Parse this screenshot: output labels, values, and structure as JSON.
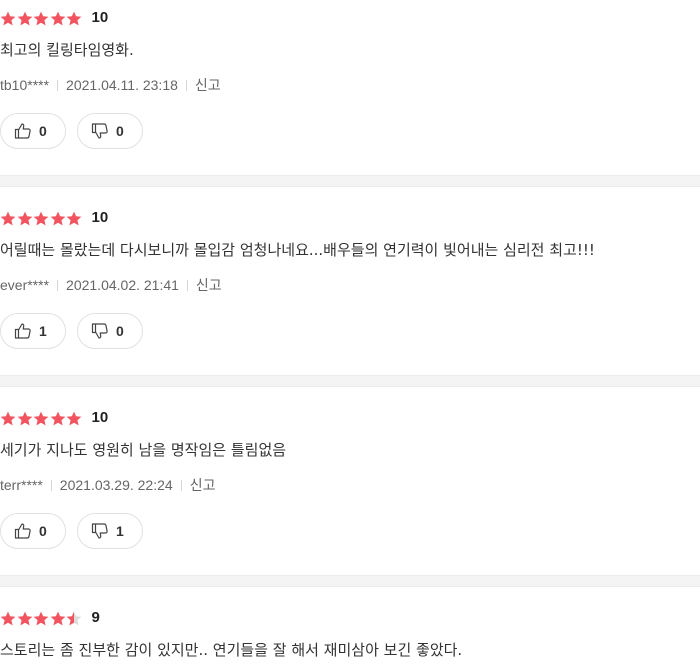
{
  "colors": {
    "star_filled": "#f2545f",
    "star_empty": "#dcdcdc"
  },
  "reviews": [
    {
      "stars": 5,
      "score": "10",
      "comment": "최고의 킬링타임영화.",
      "author": "tb10****",
      "datetime": "2021.04.11. 23:18",
      "report_label": "신고",
      "likes": "0",
      "dislikes": "0"
    },
    {
      "stars": 5,
      "score": "10",
      "comment": "어릴때는 몰랐는데 다시보니까 몰입감 엄청나네요...배우들의 연기력이 빛어내는 심리전 최고!!!",
      "author": "ever****",
      "datetime": "2021.04.02. 21:41",
      "report_label": "신고",
      "likes": "1",
      "dislikes": "0"
    },
    {
      "stars": 5,
      "score": "10",
      "comment": "세기가 지나도 영원히 남을 명작임은 틀림없음",
      "author": "terr****",
      "datetime": "2021.03.29. 22:24",
      "report_label": "신고",
      "likes": "0",
      "dislikes": "1"
    },
    {
      "stars": 4.5,
      "score": "9",
      "comment": "스토리는 좀 진부한 감이 있지만.. 연기들을 잘 해서 재미삼아 보긴 좋았다.",
      "author": "",
      "datetime": "",
      "report_label": "",
      "likes": "",
      "dislikes": ""
    }
  ]
}
